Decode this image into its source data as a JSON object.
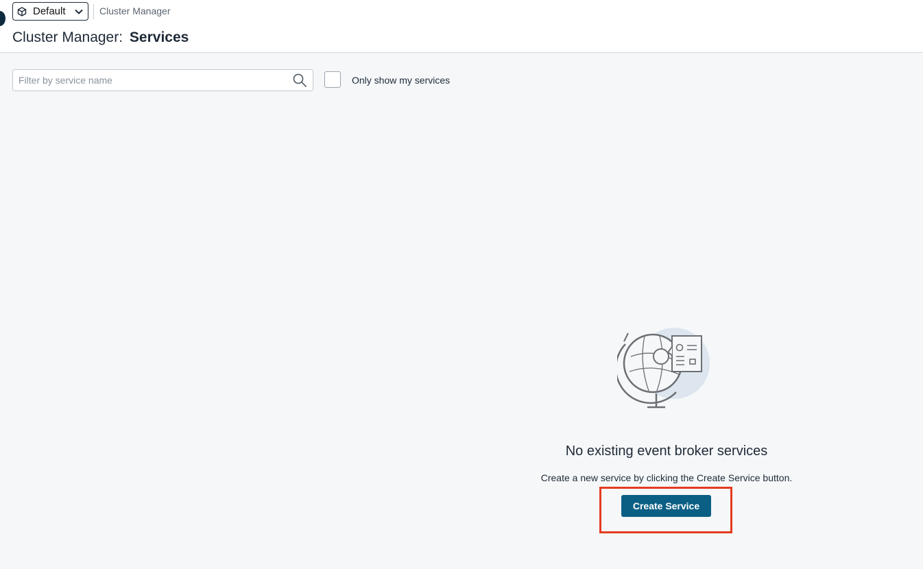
{
  "header": {
    "environment_selector": {
      "value": "Default",
      "icon": "cube-icon"
    },
    "breadcrumb": "Cluster Manager",
    "title_prefix": "Cluster Manager:",
    "title_main": "Services"
  },
  "filters": {
    "search_placeholder": "Filter by service name",
    "search_value": "",
    "only_mine_label": "Only show my services",
    "only_mine_checked": false
  },
  "empty_state": {
    "illustration": "globe-document-icon",
    "title": "No existing event broker services",
    "subtitle": "Create a new service by clicking the Create Service button.",
    "create_button_label": "Create Service"
  },
  "colors": {
    "primary_button": "#0b5f85",
    "highlight_box": "#e53b1f",
    "page_bg": "#f5f7f9"
  }
}
